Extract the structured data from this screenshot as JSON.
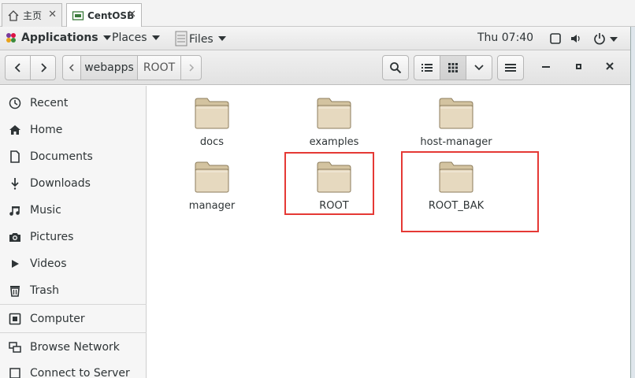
{
  "host_tabs": [
    {
      "label": "主页",
      "active": false
    },
    {
      "label": "CentOSB",
      "active": true
    }
  ],
  "topbar": {
    "applications": "Applications",
    "places": "Places",
    "files": "Files",
    "clock": "Thu 07:40"
  },
  "header": {
    "breadcrumb": [
      "webapps",
      "ROOT"
    ]
  },
  "sidebar": {
    "items": [
      {
        "label": "Recent",
        "icon": "clock-icon"
      },
      {
        "label": "Home",
        "icon": "home-icon"
      },
      {
        "label": "Documents",
        "icon": "document-icon"
      },
      {
        "label": "Downloads",
        "icon": "download-icon"
      },
      {
        "label": "Music",
        "icon": "music-icon"
      },
      {
        "label": "Pictures",
        "icon": "camera-icon"
      },
      {
        "label": "Videos",
        "icon": "video-icon"
      },
      {
        "label": "Trash",
        "icon": "trash-icon"
      },
      {
        "label": "Computer",
        "icon": "computer-icon"
      },
      {
        "label": "Browse Network",
        "icon": "network-icon"
      },
      {
        "label": "Connect to Server",
        "icon": "server-icon"
      }
    ]
  },
  "folders": [
    {
      "name": "docs"
    },
    {
      "name": "examples"
    },
    {
      "name": "host-manager"
    },
    {
      "name": "manager"
    },
    {
      "name": "ROOT"
    },
    {
      "name": "ROOT_BAK"
    }
  ],
  "colors": {
    "annotation_red": "#e53935",
    "folder_body": "#e6d9bf",
    "folder_tab": "#d3c3a0"
  }
}
